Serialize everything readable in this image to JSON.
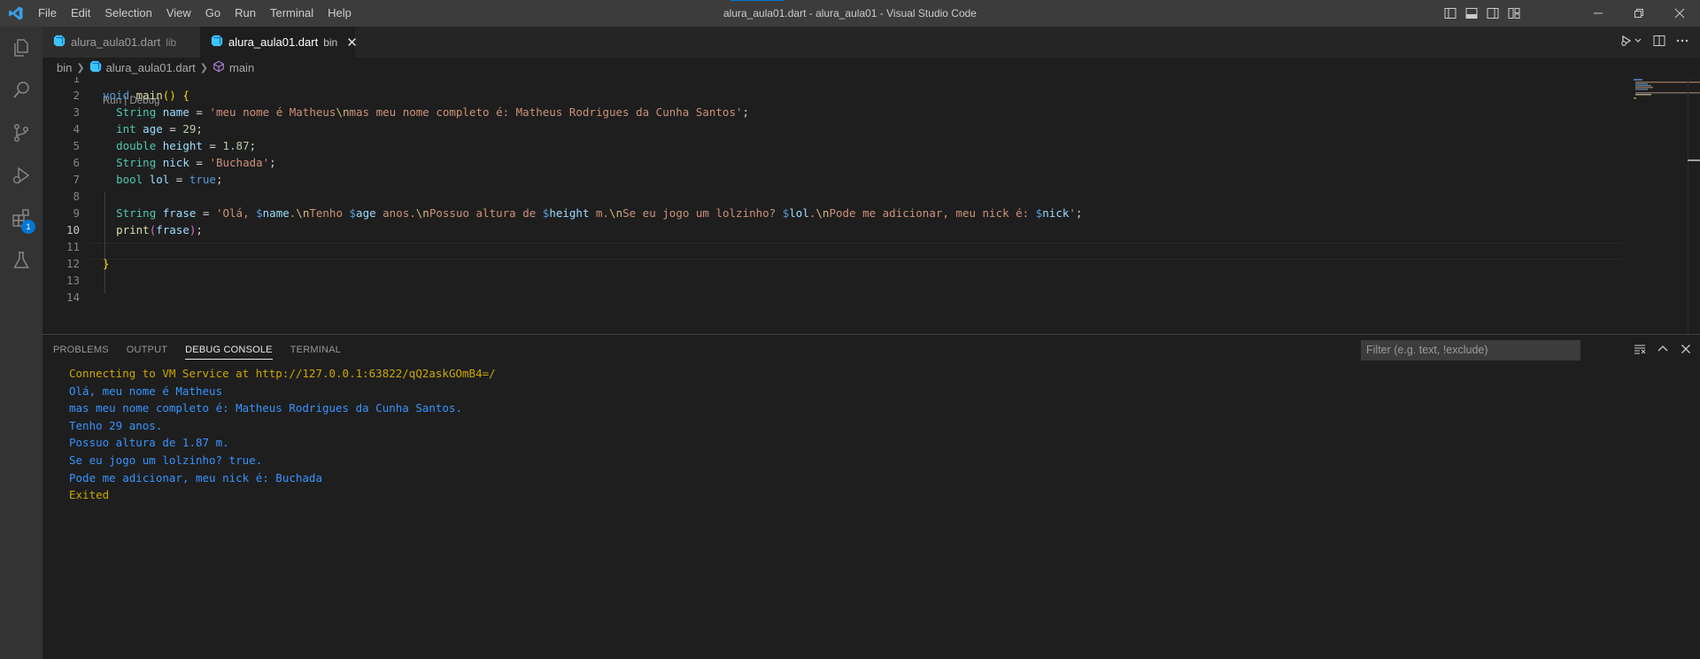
{
  "window": {
    "title": "alura_aula01.dart - alura_aula01 - Visual Studio Code",
    "menu": [
      "File",
      "Edit",
      "Selection",
      "View",
      "Go",
      "Run",
      "Terminal",
      "Help"
    ]
  },
  "activity_bar": {
    "items": [
      "explorer-icon",
      "search-icon",
      "source-control-icon",
      "run-debug-icon",
      "extensions-icon",
      "testing-icon"
    ],
    "extensions_badge": "1"
  },
  "tabs": [
    {
      "label": "alura_aula01.dart",
      "desc": "lib",
      "active": false
    },
    {
      "label": "alura_aula01.dart",
      "desc": "bin",
      "active": true
    }
  ],
  "breadcrumb": {
    "folder": "bin",
    "file": "alura_aula01.dart",
    "symbol": "main"
  },
  "editor": {
    "codelens": "Run | Debug",
    "line_numbers": [
      "1",
      "2",
      "3",
      "4",
      "5",
      "6",
      "7",
      "8",
      "9",
      "10",
      "11",
      "12",
      "13",
      "14"
    ],
    "active_line": "10"
  },
  "panel": {
    "tabs": [
      "PROBLEMS",
      "OUTPUT",
      "DEBUG CONSOLE",
      "TERMINAL"
    ],
    "active_tab": "DEBUG CONSOLE",
    "filter_placeholder": "Filter (e.g. text, !exclude)",
    "console": [
      {
        "text": "Connecting to VM Service at http://127.0.0.1:63822/qQ2askGOmB4=/",
        "kind": "info"
      },
      {
        "text": "Olá, meu nome é Matheus",
        "kind": "output"
      },
      {
        "text": "mas meu nome completo é: Matheus Rodrigues da Cunha Santos.",
        "kind": "output"
      },
      {
        "text": "Tenho 29 anos.",
        "kind": "output"
      },
      {
        "text": "Possuo altura de 1.87 m.",
        "kind": "output"
      },
      {
        "text": "Se eu jogo um lolzinho? true.",
        "kind": "output"
      },
      {
        "text": "Pode me adicionar, meu nick é: Buchada",
        "kind": "output"
      },
      {
        "text": "Exited",
        "kind": "info"
      }
    ]
  },
  "colors": {
    "accent": "#0078d4",
    "console_info": "#cca700",
    "console_output": "#3794ff"
  }
}
